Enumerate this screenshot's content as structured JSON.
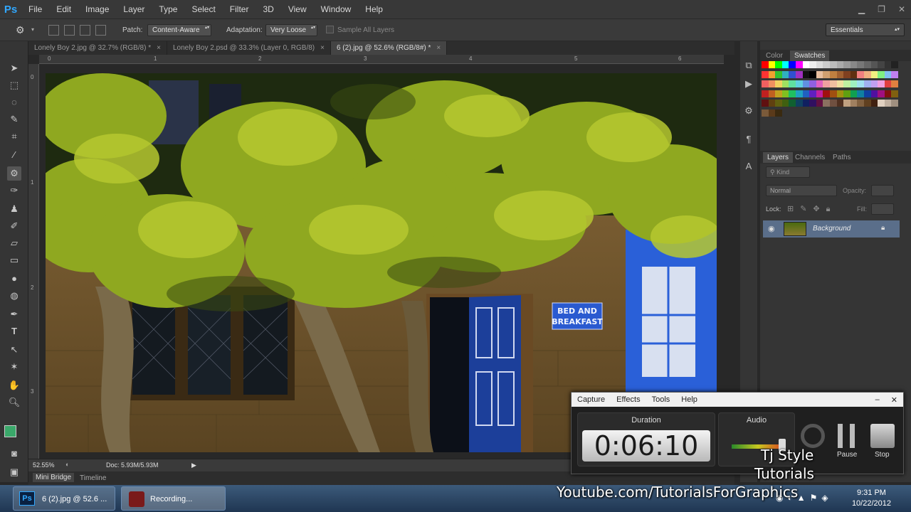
{
  "app": {
    "logo": "Ps"
  },
  "menu": [
    "File",
    "Edit",
    "Image",
    "Layer",
    "Type",
    "Select",
    "Filter",
    "3D",
    "View",
    "Window",
    "Help"
  ],
  "options": {
    "patch_label": "Patch:",
    "patch_value": "Content-Aware",
    "adaptation_label": "Adaptation:",
    "adaptation_value": "Very Loose",
    "sample_all_layers": "Sample All Layers",
    "workspace": "Essentials"
  },
  "tabs": [
    {
      "label": "Lonely Boy 2.jpg @ 32.7% (RGB/8) *"
    },
    {
      "label": "Lonely Boy 2.psd @ 33.3% (Layer 0, RGB/8)"
    },
    {
      "label": "6 (2).jpg @ 52.6% (RGB/8#) *"
    }
  ],
  "ruler_top": [
    "0",
    "1",
    "2",
    "3",
    "4",
    "5",
    "6"
  ],
  "ruler_left": [
    "0",
    "1",
    "2",
    "3"
  ],
  "photo": {
    "sign_line1": "BED AND",
    "sign_line2": "BREAKFAST"
  },
  "status": {
    "zoom": "52.55%",
    "doc": "Doc: 5.93M/5.93M"
  },
  "bottom_tabs": {
    "mini_bridge": "Mini Bridge",
    "timeline": "Timeline"
  },
  "panels": {
    "color_tab": "Color",
    "swatches_tab": "Swatches",
    "layers_tab": "Layers",
    "channels_tab": "Channels",
    "paths_tab": "Paths",
    "kind": "Kind",
    "blend_mode": "Normal",
    "opacity_label": "Opacity:",
    "lock_label": "Lock:",
    "fill_label": "Fill:",
    "layer_name": "Background"
  },
  "recorder": {
    "menu": [
      "Capture",
      "Effects",
      "Tools",
      "Help"
    ],
    "duration_label": "Duration",
    "duration_value": "0:06:10",
    "audio_label": "Audio",
    "pause_label": "Pause",
    "stop_label": "Stop"
  },
  "watermark": {
    "line1": "Tj Style",
    "line2": "Tutorials",
    "url": "Youtube.com/TutorialsForGraphics"
  },
  "taskbar": {
    "ps_task": "6 (2).jpg @ 52.6 ...",
    "rec_task": "Recording...",
    "time": "9:31 PM",
    "date": "10/22/2012"
  },
  "colors": {
    "foreground": "#3aa86a",
    "background": "#111111",
    "accent": "#31a8ff"
  }
}
